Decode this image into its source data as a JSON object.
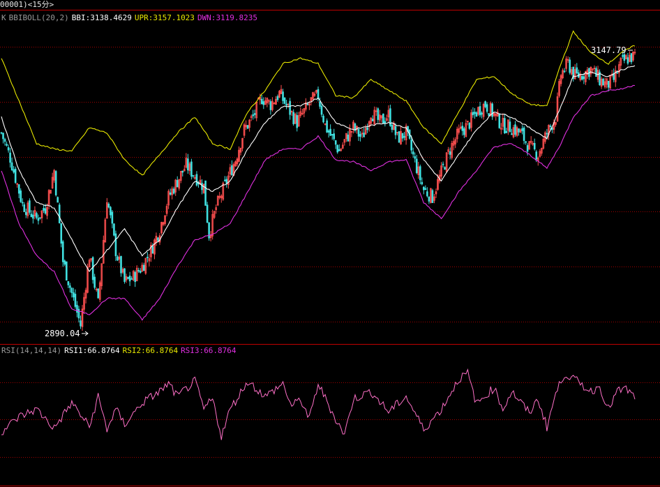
{
  "title": "00001)<15分>",
  "colors": {
    "frame": "#c00000",
    "grid": "#a00000",
    "up": "#ff5050",
    "down": "#40e0e0",
    "bbi": "#ffffff",
    "upr": "#e8e800",
    "dwn": "#e030e0",
    "rsi": "#ff70c8",
    "annotation": "#ffffff"
  },
  "main_panel": {
    "indicator": "BBIBOLL(20,2)",
    "k_label": "K",
    "bbi_label": "BBI:",
    "bbi_value": "3138.4629",
    "upr_label": "UPR:",
    "upr_value": "3157.1023",
    "dwn_label": "DWN:",
    "dwn_value": "3119.8235",
    "high_annotation": "3147.79",
    "low_annotation": "2890.04"
  },
  "rsi_panel": {
    "indicator": "RSI(14,14,14)",
    "rsi1_label": "RSI1:",
    "rsi1_value": "66.8764",
    "rsi2_label": "RSI2:",
    "rsi2_value": "66.8764",
    "rsi3_label": "RSI3:",
    "rsi3_value": "66.8764"
  },
  "chart_data": [
    {
      "type": "line",
      "name": "BBIBOLL",
      "x_index_range": [
        0,
        360
      ],
      "ylim": [
        2878,
        3178
      ],
      "series": [
        {
          "name": "K",
          "points": [
            [
              0,
              3075
            ],
            [
              5,
              3052
            ],
            [
              12,
              3008
            ],
            [
              20,
              2995
            ],
            [
              25,
              3005
            ],
            [
              30,
              3040
            ],
            [
              35,
              2955
            ],
            [
              40,
              2925
            ],
            [
              45,
              2895
            ],
            [
              50,
              2960
            ],
            [
              55,
              2915
            ],
            [
              60,
              3015
            ],
            [
              65,
              2965
            ],
            [
              70,
              2935
            ],
            [
              75,
              2940
            ],
            [
              80,
              2950
            ],
            [
              85,
              2965
            ],
            [
              90,
              2985
            ],
            [
              95,
              3015
            ],
            [
              100,
              3030
            ],
            [
              105,
              3045
            ],
            [
              110,
              3035
            ],
            [
              115,
              3025
            ],
            [
              118,
              2980
            ],
            [
              122,
              3005
            ],
            [
              128,
              3030
            ],
            [
              133,
              3050
            ],
            [
              138,
              3078
            ],
            [
              143,
              3090
            ],
            [
              148,
              3108
            ],
            [
              153,
              3102
            ],
            [
              158,
              3112
            ],
            [
              163,
              3098
            ],
            [
              168,
              3085
            ],
            [
              172,
              3095
            ],
            [
              176,
              3105
            ],
            [
              180,
              3110
            ],
            [
              184,
              3082
            ],
            [
              188,
              3070
            ],
            [
              192,
              3058
            ],
            [
              196,
              3070
            ],
            [
              200,
              3080
            ],
            [
              205,
              3070
            ],
            [
              210,
              3095
            ],
            [
              215,
              3085
            ],
            [
              220,
              3092
            ],
            [
              225,
              3070
            ],
            [
              230,
              3075
            ],
            [
              235,
              3048
            ],
            [
              240,
              3022
            ],
            [
              245,
              3015
            ],
            [
              250,
              3038
            ],
            [
              255,
              3060
            ],
            [
              260,
              3075
            ],
            [
              265,
              3082
            ],
            [
              270,
              3095
            ],
            [
              275,
              3102
            ],
            [
              280,
              3092
            ],
            [
              285,
              3082
            ],
            [
              290,
              3080
            ],
            [
              295,
              3075
            ],
            [
              300,
              3062
            ],
            [
              305,
              3055
            ],
            [
              310,
              3075
            ],
            [
              315,
              3090
            ],
            [
              318,
              3130
            ],
            [
              322,
              3140
            ],
            [
              326,
              3128
            ],
            [
              330,
              3130
            ],
            [
              335,
              3135
            ],
            [
              340,
              3125
            ],
            [
              344,
              3120
            ],
            [
              348,
              3125
            ],
            [
              352,
              3140
            ],
            [
              356,
              3145
            ],
            [
              360,
              3147
            ]
          ]
        },
        {
          "name": "BBI",
          "points": [
            [
              0,
              3090
            ],
            [
              10,
              3040
            ],
            [
              20,
              3010
            ],
            [
              30,
              3005
            ],
            [
              40,
              2975
            ],
            [
              50,
              2945
            ],
            [
              60,
              2965
            ],
            [
              70,
              2985
            ],
            [
              80,
              2960
            ],
            [
              90,
              2975
            ],
            [
              100,
              3005
            ],
            [
              110,
              3030
            ],
            [
              120,
              3020
            ],
            [
              130,
              3030
            ],
            [
              140,
              3060
            ],
            [
              150,
              3085
            ],
            [
              160,
              3100
            ],
            [
              170,
              3100
            ],
            [
              180,
              3108
            ],
            [
              190,
              3085
            ],
            [
              200,
              3078
            ],
            [
              210,
              3082
            ],
            [
              220,
              3085
            ],
            [
              230,
              3080
            ],
            [
              240,
              3050
            ],
            [
              250,
              3030
            ],
            [
              260,
              3055
            ],
            [
              270,
              3078
            ],
            [
              280,
              3095
            ],
            [
              290,
              3090
            ],
            [
              300,
              3080
            ],
            [
              310,
              3070
            ],
            [
              318,
              3100
            ],
            [
              325,
              3128
            ],
            [
              335,
              3132
            ],
            [
              345,
              3128
            ],
            [
              352,
              3134
            ],
            [
              360,
              3138
            ]
          ]
        },
        {
          "name": "UPR",
          "points": [
            [
              0,
              3145
            ],
            [
              10,
              3105
            ],
            [
              20,
              3065
            ],
            [
              30,
              3060
            ],
            [
              40,
              3058
            ],
            [
              50,
              3080
            ],
            [
              60,
              3075
            ],
            [
              70,
              3050
            ],
            [
              80,
              3035
            ],
            [
              90,
              3055
            ],
            [
              100,
              3075
            ],
            [
              110,
              3090
            ],
            [
              120,
              3065
            ],
            [
              130,
              3060
            ],
            [
              140,
              3095
            ],
            [
              150,
              3115
            ],
            [
              160,
              3140
            ],
            [
              170,
              3145
            ],
            [
              180,
              3140
            ],
            [
              190,
              3110
            ],
            [
              200,
              3108
            ],
            [
              210,
              3125
            ],
            [
              220,
              3115
            ],
            [
              230,
              3105
            ],
            [
              240,
              3080
            ],
            [
              250,
              3065
            ],
            [
              260,
              3095
            ],
            [
              270,
              3125
            ],
            [
              280,
              3128
            ],
            [
              290,
              3112
            ],
            [
              300,
              3102
            ],
            [
              310,
              3100
            ],
            [
              318,
              3140
            ],
            [
              325,
              3170
            ],
            [
              335,
              3150
            ],
            [
              345,
              3140
            ],
            [
              352,
              3150
            ],
            [
              360,
              3157
            ]
          ]
        },
        {
          "name": "DWN",
          "points": [
            [
              0,
              3040
            ],
            [
              10,
              2990
            ],
            [
              20,
              2960
            ],
            [
              30,
              2945
            ],
            [
              40,
              2910
            ],
            [
              50,
              2905
            ],
            [
              60,
              2920
            ],
            [
              70,
              2920
            ],
            [
              80,
              2900
            ],
            [
              90,
              2920
            ],
            [
              100,
              2950
            ],
            [
              110,
              2975
            ],
            [
              120,
              2980
            ],
            [
              130,
              2990
            ],
            [
              140,
              3020
            ],
            [
              150,
              3050
            ],
            [
              160,
              3060
            ],
            [
              170,
              3060
            ],
            [
              180,
              3072
            ],
            [
              190,
              3050
            ],
            [
              200,
              3048
            ],
            [
              210,
              3040
            ],
            [
              220,
              3048
            ],
            [
              230,
              3050
            ],
            [
              240,
              3010
            ],
            [
              250,
              2995
            ],
            [
              260,
              3020
            ],
            [
              270,
              3040
            ],
            [
              280,
              3062
            ],
            [
              290,
              3065
            ],
            [
              300,
              3055
            ],
            [
              310,
              3042
            ],
            [
              318,
              3065
            ],
            [
              325,
              3090
            ],
            [
              335,
              3110
            ],
            [
              345,
              3115
            ],
            [
              352,
              3116
            ],
            [
              360,
              3120
            ]
          ]
        }
      ]
    },
    {
      "type": "line",
      "name": "RSI",
      "x_index_range": [
        0,
        360
      ],
      "ylim": [
        0,
        100
      ],
      "series": [
        {
          "name": "RSI1",
          "points": [
            [
              0,
              40
            ],
            [
              10,
              52
            ],
            [
              20,
              58
            ],
            [
              30,
              43
            ],
            [
              40,
              63
            ],
            [
              50,
              44
            ],
            [
              55,
              68
            ],
            [
              60,
              42
            ],
            [
              65,
              58
            ],
            [
              70,
              46
            ],
            [
              80,
              63
            ],
            [
              90,
              72
            ],
            [
              95,
              78
            ],
            [
              100,
              68
            ],
            [
              110,
              80
            ],
            [
              115,
              58
            ],
            [
              120,
              66
            ],
            [
              125,
              37
            ],
            [
              130,
              58
            ],
            [
              140,
              80
            ],
            [
              150,
              68
            ],
            [
              160,
              78
            ],
            [
              165,
              60
            ],
            [
              170,
              66
            ],
            [
              175,
              50
            ],
            [
              180,
              78
            ],
            [
              190,
              50
            ],
            [
              195,
              38
            ],
            [
              200,
              66
            ],
            [
              210,
              72
            ],
            [
              220,
              56
            ],
            [
              230,
              68
            ],
            [
              240,
              42
            ],
            [
              250,
              58
            ],
            [
              260,
              82
            ],
            [
              265,
              86
            ],
            [
              270,
              62
            ],
            [
              280,
              75
            ],
            [
              285,
              58
            ],
            [
              290,
              72
            ],
            [
              300,
              55
            ],
            [
              305,
              66
            ],
            [
              310,
              44
            ],
            [
              315,
              70
            ],
            [
              320,
              86
            ],
            [
              325,
              82
            ],
            [
              335,
              72
            ],
            [
              340,
              76
            ],
            [
              345,
              58
            ],
            [
              350,
              72
            ],
            [
              355,
              74
            ],
            [
              360,
              67
            ]
          ]
        }
      ]
    }
  ]
}
